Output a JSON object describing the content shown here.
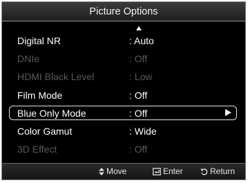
{
  "window": {
    "title": "Picture Options"
  },
  "menu": {
    "items": [
      {
        "label": "Digital NR",
        "value": ": Auto",
        "enabled": true
      },
      {
        "label": "DNIe",
        "value": ": Off",
        "enabled": false
      },
      {
        "label": "HDMI Black Level",
        "value": ": Low",
        "enabled": false
      },
      {
        "label": "Film Mode",
        "value": ": Off",
        "enabled": true
      },
      {
        "label": "Blue Only Mode",
        "value": ": Off",
        "enabled": true,
        "selected": true
      },
      {
        "label": "Color Gamut",
        "value": ": Wide",
        "enabled": true
      },
      {
        "label": "3D Effect",
        "value": ": Off",
        "enabled": false
      }
    ]
  },
  "footer": {
    "move": {
      "icon": "up-down-arrows-icon",
      "label": "Move"
    },
    "enter": {
      "icon": "enter-icon",
      "label": "Enter"
    },
    "return": {
      "icon": "return-icon",
      "label": "Return"
    }
  },
  "colors": {
    "background": "#000000",
    "text_enabled": "#ffffff",
    "text_disabled": "#5a5a5a",
    "border": "#9a9a9a"
  }
}
